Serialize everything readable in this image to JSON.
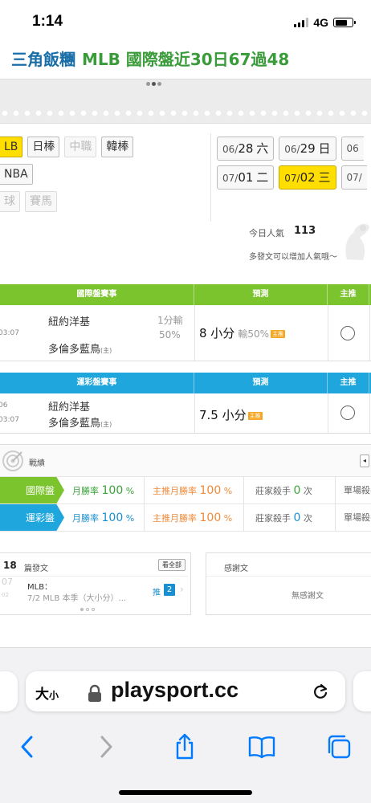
{
  "status_bar": {
    "time": "1:14",
    "network": "4G"
  },
  "header": {
    "blog_name": "三角飯糰",
    "record": "MLB 國際盤近30日67過48"
  },
  "league_tags": {
    "row1": [
      {
        "label": "LB",
        "active": true,
        "disabled": false
      },
      {
        "label": "日棒",
        "active": false,
        "disabled": false
      },
      {
        "label": "中職",
        "active": false,
        "disabled": true
      },
      {
        "label": "韓棒",
        "active": false,
        "disabled": false
      }
    ],
    "row2": [
      {
        "label": "NBA",
        "active": false,
        "disabled": false
      }
    ],
    "row3": [
      {
        "label": "球",
        "active": false,
        "disabled": true
      },
      {
        "label": "賽馬",
        "active": false,
        "disabled": true
      }
    ]
  },
  "dates": {
    "row1": [
      {
        "md": "06/",
        "day": "28",
        "wd": "六",
        "active": false
      },
      {
        "md": "06/",
        "day": "29",
        "wd": "日",
        "active": false
      },
      {
        "md": "06",
        "day": "",
        "wd": "",
        "active": false
      }
    ],
    "row2": [
      {
        "md": "07/",
        "day": "01",
        "wd": "二",
        "active": false
      },
      {
        "md": "07/",
        "day": "02",
        "wd": "三",
        "active": true
      },
      {
        "md": "07/",
        "day": "",
        "wd": "",
        "active": false
      }
    ]
  },
  "popularity": {
    "label": "今日人氣",
    "value": "113",
    "hint": "多發文可以增加人氣哦～"
  },
  "intl_table": {
    "headers": {
      "game": "國際盤賽事",
      "prediction": "預測",
      "main": "主推"
    },
    "row": {
      "time": "03:07",
      "team_away": "紐約洋基",
      "team_home": "多倫多藍鳥",
      "home_mark": "(主)",
      "handicap_line1": "1分輸",
      "handicap_line2": "50%",
      "pick": "8 小分",
      "pick_detail": "輸50%",
      "badge": "主推"
    }
  },
  "lottery_table": {
    "headers": {
      "game": "運彩盤賽事",
      "prediction": "預測",
      "main": "主推"
    },
    "row": {
      "time_line1": "06",
      "time_line2": "03:07",
      "team_away": "紐約洋基",
      "team_home": "多倫多藍鳥",
      "home_mark": "(主)",
      "pick": "7.5 小分",
      "badge": "主推"
    }
  },
  "stats": {
    "title": "戰績",
    "more_icon": "more-tab",
    "rows": [
      {
        "label": "國際盤",
        "win_label": "月勝率",
        "win": "100",
        "main_label": "主推月勝率",
        "main": "100",
        "killer_label": "莊家殺手",
        "killer": "0",
        "killer_unit": "次",
        "single_label": "單場殺手"
      },
      {
        "label": "運彩盤",
        "win_label": "月勝率",
        "win": "100",
        "main_label": "主推月勝率",
        "main": "100",
        "killer_label": "莊家殺手",
        "killer": "0",
        "killer_unit": "次",
        "single_label": "單場殺手"
      }
    ],
    "percent": "%"
  },
  "posts": {
    "count": "18",
    "title": "篇發文",
    "see_all": "看全部",
    "item": {
      "date_month": "07",
      "date_day": "02",
      "line1": "MLB：",
      "line2": "7/2 MLB 本季（大小分）...",
      "push_label": "推",
      "push_count": "2"
    }
  },
  "thanks": {
    "title": "感謝文",
    "empty": "無感謝文"
  },
  "browser": {
    "text_size": "大",
    "text_size_small": "小",
    "url": "playsport.cc"
  },
  "colors": {
    "intl_green": "#7cc42d",
    "lottery_blue": "#1ea6dd",
    "active_yellow": "#ffde00",
    "blog_blue": "#1a6ea8",
    "record_green": "#3a9b3a",
    "ios_blue": "#007aff"
  }
}
